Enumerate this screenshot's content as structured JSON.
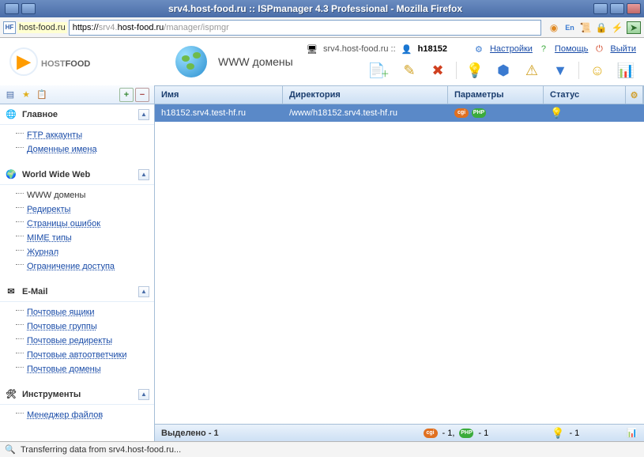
{
  "window": {
    "title": "srv4.host-food.ru :: ISPmanager 4.3 Professional - Mozilla Firefox"
  },
  "address": {
    "domain": "host-food.ru",
    "scheme": "https://",
    "host_grey_prefix": "srv4.",
    "host_grey_suffix": "/manager/ispmgr",
    "favicon_label": "HF"
  },
  "logo": {
    "brand_a": "HOST",
    "brand_b": "FOOD"
  },
  "section_title": "WWW домены",
  "topbar": {
    "site_label": "srv4.host-food.ru ::",
    "user_label": "h18152",
    "links": {
      "settings": "Настройки",
      "help": "Помощь",
      "logout": "Выйти"
    }
  },
  "sidebar_toolbar": {
    "plus": "+",
    "minus": "−"
  },
  "sidebar": {
    "groups": [
      {
        "name": "main",
        "label": "Главное",
        "icon": "🌐",
        "items": [
          {
            "label": "FTP аккаунты"
          },
          {
            "label": "Доменные имена"
          }
        ]
      },
      {
        "name": "www",
        "label": "World Wide Web",
        "icon": "🌍",
        "items": [
          {
            "label": "WWW домены",
            "active": true
          },
          {
            "label": "Редиректы"
          },
          {
            "label": "Страницы ошибок"
          },
          {
            "label": "MIME типы"
          },
          {
            "label": "Журнал"
          },
          {
            "label": "Ограничение доступа"
          }
        ]
      },
      {
        "name": "email",
        "label": "E-Mail",
        "icon": "✉",
        "items": [
          {
            "label": "Почтовые ящики"
          },
          {
            "label": "Почтовые группы"
          },
          {
            "label": "Почтовые редиректы"
          },
          {
            "label": "Почтовые автоответчики"
          },
          {
            "label": "Почтовые домены"
          }
        ]
      },
      {
        "name": "tools",
        "label": "Инструменты",
        "icon": "🛠",
        "items": [
          {
            "label": "Менеджер файлов"
          }
        ]
      }
    ]
  },
  "table": {
    "headers": {
      "name": "Имя",
      "dir": "Директория",
      "par": "Параметры",
      "stat": "Статус"
    },
    "rows": [
      {
        "name": "h18152.srv4.test-hf.ru",
        "dir": "/www/h18152.srv4.test-hf.ru",
        "badges": {
          "cgi": "cgi",
          "php": "PHP"
        }
      }
    ]
  },
  "footer": {
    "selected_label": "Выделено - 1",
    "cgi_count": " - 1, ",
    "php_count": " - 1",
    "status_count": " - 1"
  },
  "statusbar": {
    "text": "Transferring data from srv4.host-food.ru..."
  }
}
